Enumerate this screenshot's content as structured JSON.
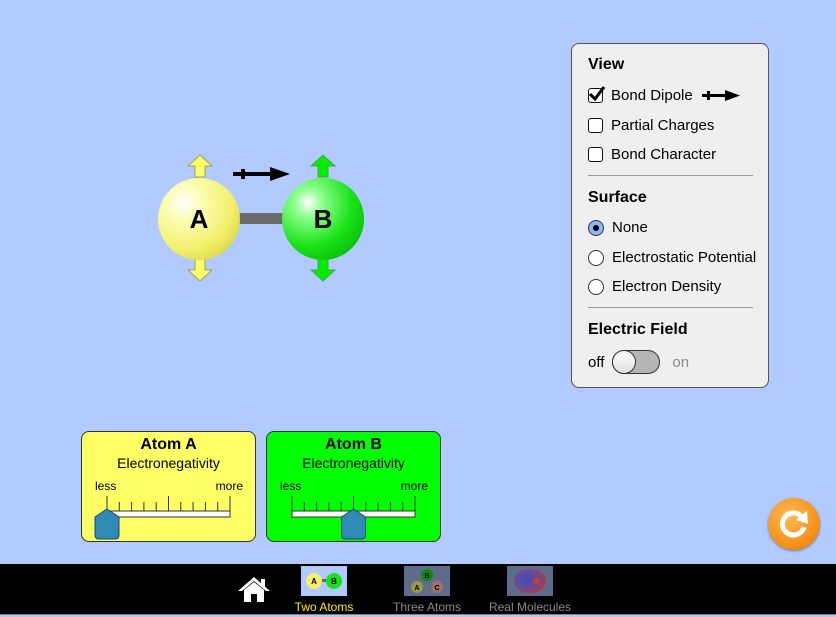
{
  "molecule": {
    "atom_a_label": "A",
    "atom_b_label": "B",
    "atom_a_color": "#f2f06a",
    "atom_b_color": "#17e317"
  },
  "view_panel": {
    "view_heading": "View",
    "checkboxes": [
      {
        "label": "Bond Dipole",
        "checked": true
      },
      {
        "label": "Partial Charges",
        "checked": false
      },
      {
        "label": "Bond Character",
        "checked": false
      }
    ],
    "surface_heading": "Surface",
    "surface_options": [
      {
        "label": "None",
        "selected": true
      },
      {
        "label": "Electrostatic Potential",
        "selected": false
      },
      {
        "label": "Electron Density",
        "selected": false
      }
    ],
    "electric_field_heading": "Electric Field",
    "toggle_off_label": "off",
    "toggle_on_label": "on",
    "electric_field_on": false
  },
  "electronegativity": [
    {
      "title": "Atom A",
      "subtitle": "Electronegativity",
      "less_label": "less",
      "more_label": "more",
      "value_fraction": 0.0,
      "color": "#ffff66"
    },
    {
      "title": "Atom B",
      "subtitle": "Electronegativity",
      "less_label": "less",
      "more_label": "more",
      "value_fraction": 0.5,
      "color": "#00ff00"
    }
  ],
  "navbar": {
    "screens": [
      {
        "label": "Two Atoms",
        "selected": true
      },
      {
        "label": "Three Atoms",
        "selected": false
      },
      {
        "label": "Real Molecules",
        "selected": false
      }
    ],
    "three_atoms_thumb_labels": [
      "A",
      "B",
      "C"
    ],
    "two_atoms_thumb_labels": [
      "A",
      "B"
    ]
  },
  "colors": {
    "background": "#b1caff",
    "panel": "#efefef",
    "slider_thumb": "#2f8bb5",
    "reset": "#f7941d",
    "selected_screen_label": "#ffea00"
  }
}
